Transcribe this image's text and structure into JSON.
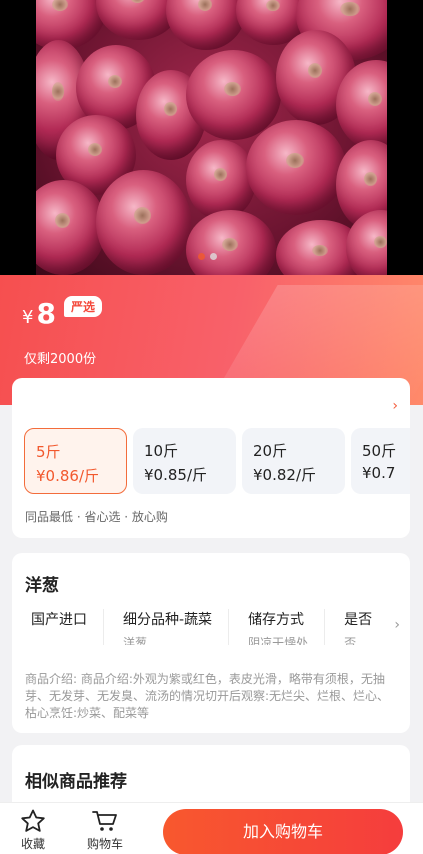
{
  "product": {
    "image_alt": "",
    "currency": "¥",
    "price": "8",
    "tag": "严选",
    "stock": "仅剩2000份"
  },
  "hero": {
    "slides": 2,
    "active": 1
  },
  "specs": [
    {
      "weight": "5斤",
      "unit_price": "¥0.86/斤",
      "selected": true
    },
    {
      "weight": "10斤",
      "unit_price": "¥0.85/斤",
      "selected": false
    },
    {
      "weight": "20斤",
      "unit_price": "¥0.82/斤",
      "selected": false
    },
    {
      "weight": "50斤",
      "unit_price": "¥0.7",
      "selected": false
    }
  ],
  "promise": "同品最低 · 省心选 · 放心购",
  "info": {
    "title": "洋葱",
    "attributes": [
      {
        "name": "国产进口",
        "value": ""
      },
      {
        "name": "细分品种-蔬菜",
        "value": "洋葱"
      },
      {
        "name": "储存方式",
        "value": "阴凉干燥处"
      },
      {
        "name": "是否",
        "value": "否"
      }
    ],
    "description": "商品介绍: 商品介绍:外观为紫或红色，表皮光滑，略带有须根，无抽芽、无发芽、无发臭、流汤的情况切开后观察:无烂尖、烂根、烂心、枯心烹饪:炒菜、配菜等"
  },
  "recommend": {
    "title": "相似商品推荐"
  },
  "bottom_bar": {
    "favorite_label": "收藏",
    "cart_label": "购物车",
    "add_to_cart_label": "加入购物车"
  },
  "colors": {
    "accent": "#f5503a",
    "banner_start": "#f64f4f",
    "banner_end": "#ff8a6a"
  }
}
